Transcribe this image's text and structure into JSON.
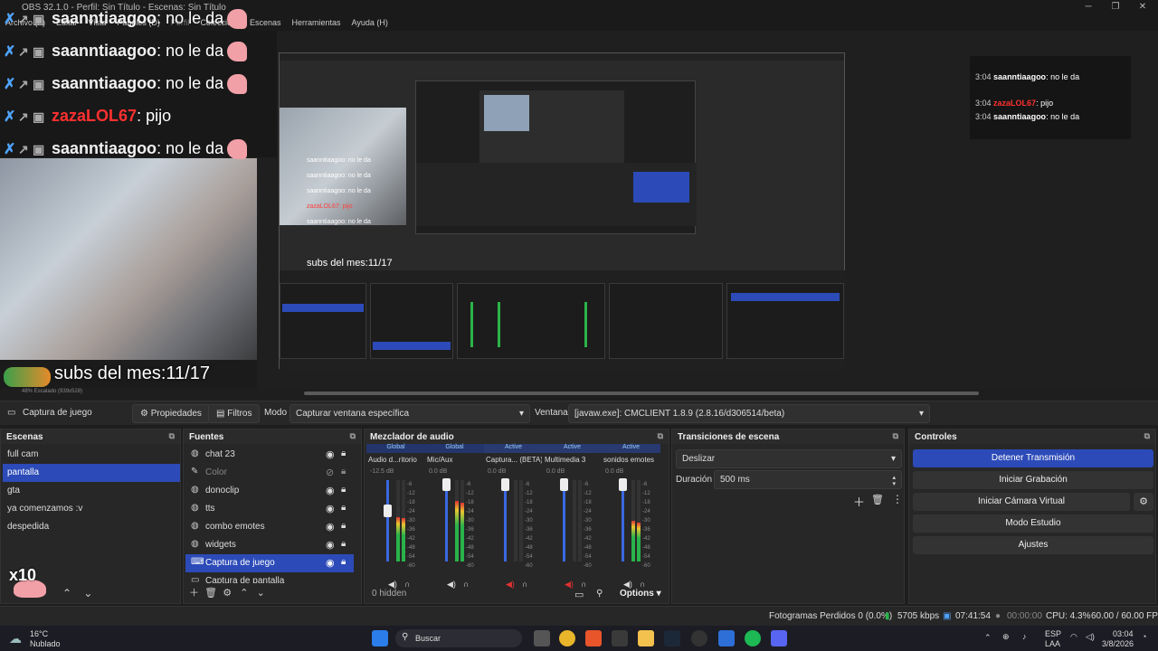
{
  "titlebar": {
    "title": "OBS 32.1.0 - Perfil: Sin Título - Escenas: Sin Título",
    "min": "─",
    "max": "❐",
    "close": "✕"
  },
  "menu": [
    "Archivo (F)",
    "Editar",
    "Vista",
    "Paneles (D)",
    "Perfil",
    "Colección de Escenas",
    "Herramientas",
    "Ayuda (H)"
  ],
  "preview": {
    "chat": [
      {
        "user": "saannti",
        "user_rest": "aagoo",
        "msg": ": no le da",
        "style": "white"
      },
      {
        "user": "saannti",
        "user_rest": "aagoo",
        "msg": ": no le da",
        "style": "white"
      },
      {
        "user": "saannti",
        "user_rest": "aagoo",
        "msg": ": no le da",
        "style": "white"
      },
      {
        "user": "zazaLOL67",
        "user_rest": "",
        "msg": ": pijo",
        "style": "red"
      },
      {
        "user": "saannti",
        "user_rest": "aagoo",
        "msg": ": no le da",
        "style": "white"
      }
    ],
    "subs_text": "subs del mes:11/17",
    "nested_subs_text": "subs del mes:11/17",
    "nested_chat": [
      {
        "msg": "saanntiaagoo: no le da"
      },
      {
        "msg": "saanntiaagoo: no le da"
      },
      {
        "msg": "saanntiaagoo: no le da"
      },
      {
        "msg": "zazaLOL67: pijo"
      },
      {
        "msg": "saanntiaagoo: no le da"
      }
    ],
    "mini_chat": [
      {
        "time": "3:04",
        "user": "saanntiaagoo",
        "msg": ": no le da",
        "red": false
      },
      {
        "time": "3:04",
        "user": "zazaLOL67",
        "msg": ": pijo",
        "red": true
      },
      {
        "time": "3:04",
        "user": "saanntiaagoo",
        "msg": ": no le da",
        "red": false
      }
    ],
    "badge_x10": "x10",
    "zoom_label": "48%   Escalado (939x528)"
  },
  "sourcebar": {
    "source_name": "Captura de juego",
    "properties": "Propiedades",
    "filters": "Filtros",
    "mode_label": "Modo",
    "mode_value": "Capturar ventana específica",
    "window_label": "Ventana",
    "window_value": "[javaw.exe]: CMCLIENT 1.8.9 (2.8.16/d306514/beta)"
  },
  "scenes": {
    "title": "Escenas",
    "items": [
      "full cam",
      "pantalla",
      "gta",
      "ya comenzamos :v",
      "despedida"
    ],
    "selected": 1
  },
  "sources": {
    "title": "Fuentes",
    "items": [
      {
        "label": "chat 23",
        "icon": "globe-icon"
      },
      {
        "label": "Color",
        "icon": "brush-icon"
      },
      {
        "label": "donoclip",
        "icon": "globe-icon"
      },
      {
        "label": "tts",
        "icon": "globe-icon"
      },
      {
        "label": "combo emotes",
        "icon": "globe-icon"
      },
      {
        "label": "widgets",
        "icon": "globe-icon"
      },
      {
        "label": "Captura de juego",
        "icon": "gamepad-icon"
      },
      {
        "label": "Captura de pantalla",
        "icon": "monitor-icon"
      }
    ],
    "selected": 6
  },
  "mixer": {
    "title": "Mezclador de audio",
    "hidden_label": "0 hidden",
    "options_label": "Options",
    "channels": [
      {
        "tag": "Global",
        "name": "Audio d...ritorio",
        "db": "-12.5 dB",
        "level": 0.55,
        "volume": 0.62,
        "muted": false
      },
      {
        "tag": "Global",
        "name": "Mic/Aux",
        "db": "0.0 dB",
        "level": 0.75,
        "volume": 0.95,
        "muted": false
      },
      {
        "tag": "Active",
        "name": "Captura... (BETA)",
        "db": "0.0 dB",
        "level": 0.0,
        "volume": 0.95,
        "muted": true
      },
      {
        "tag": "Active",
        "name": "Multimedia 3",
        "db": "0.0 dB",
        "level": 0.0,
        "volume": 0.95,
        "muted": true
      },
      {
        "tag": "Active",
        "name": "sonidos emotes",
        "db": "0.0 dB",
        "level": 0.5,
        "volume": 0.95,
        "muted": false
      }
    ],
    "scale": [
      "-6",
      "-12",
      "-18",
      "-24",
      "-30",
      "-36",
      "-42",
      "-48",
      "-54",
      "-60"
    ]
  },
  "transitions": {
    "title": "Transiciones de escena",
    "type": "Deslizar",
    "duration_label": "Duración",
    "duration_value": "500 ms"
  },
  "controls": {
    "title": "Controles",
    "buttons": [
      "Detener Transmisión",
      "Iniciar Grabación",
      "Iniciar Cámara Virtual",
      "Modo Estudio",
      "Ajustes"
    ]
  },
  "status": {
    "dropped": "Fotogramas Perdidos 0 (0.0%)",
    "bitrate": "5705 kbps",
    "stream_time": "07:41:54",
    "rec_time": "00:00:00",
    "cpu": "CPU: 4.3%",
    "fps": "60.00 / 60.00 FPS"
  },
  "taskbar": {
    "weather_temp": "16°C",
    "weather_desc": "Nublado",
    "search": "Buscar",
    "lang": "ESP",
    "lang2": "LAA",
    "time": "03:04",
    "date": "3/8/2026"
  },
  "colors": {
    "accent": "#2c4bb8",
    "panel": "#272727",
    "bg": "#1f1e1f"
  }
}
